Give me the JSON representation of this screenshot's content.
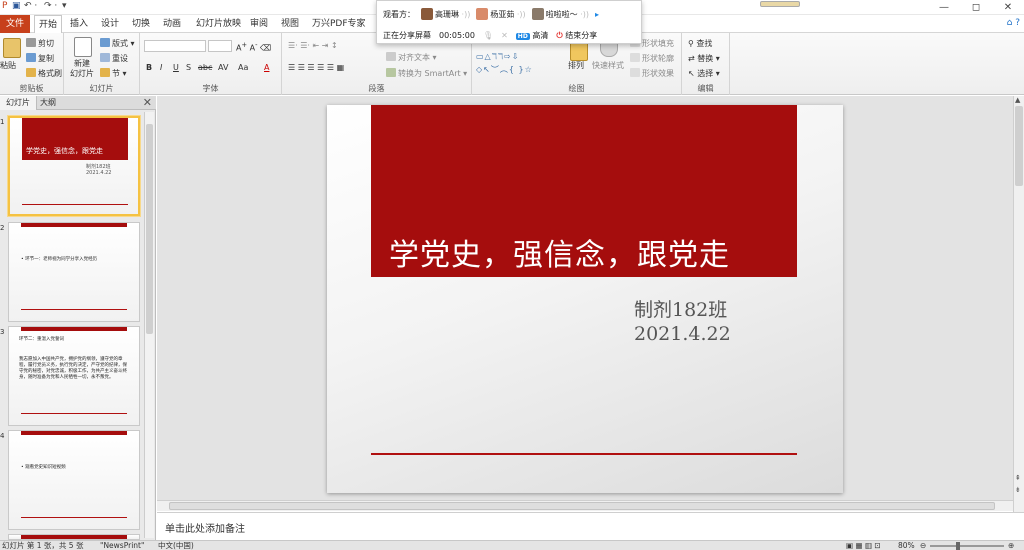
{
  "quick_access": [
    "save-icon",
    "undo-icon",
    "redo-icon"
  ],
  "window_controls": [
    "—",
    "◻",
    "✕"
  ],
  "ribbon_tabs": [
    "文件",
    "开始",
    "插入",
    "设计",
    "切换",
    "动画",
    "幻灯片放映",
    "审阅",
    "视图",
    "万兴PDF专家"
  ],
  "ribbon": {
    "clipboard": {
      "paste": "粘贴",
      "cut": "剪切",
      "copy": "复制",
      "format_painter": "格式刷",
      "label": "剪贴板"
    },
    "slides": {
      "new_slide": "新建\n幻灯片",
      "layout": "版式",
      "reset": "重设",
      "section": "节",
      "label": "幻灯片"
    },
    "font": {
      "label": "字体",
      "bold": "B",
      "italic": "I",
      "underline": "U",
      "strike": "S",
      "abc": "abc",
      "av": "AV",
      "aa": "Aa",
      "a_color": "A"
    },
    "paragraph": {
      "label": "段落",
      "align_text": "对齐文本",
      "smartart": "转换为 SmartArt"
    },
    "drawing": {
      "arrange": "排列",
      "quick_styles": "快速样式",
      "fill": "形状填充",
      "outline": "形状轮廓",
      "effects": "形状效果",
      "label": "绘图"
    },
    "editing": {
      "find": "查找",
      "replace": "替换",
      "select": "选择",
      "label": "编辑"
    }
  },
  "share": {
    "viewers_label": "观看方：",
    "viewers": [
      "高珊琳",
      "杨亚茹",
      "啦啦啦～"
    ],
    "sharing_status": "正在分享屏幕",
    "elapsed": "00:05:00",
    "hd": "HD",
    "hd_label": "高清",
    "end_share": "结束分享"
  },
  "left_pane": {
    "tabs": [
      "幻灯片",
      "大纲"
    ],
    "close": "✕",
    "slides": [
      {
        "number": "1",
        "title": "学党史，强信念，跟党走",
        "sub": "制剂182班\n2021.4.22"
      },
      {
        "number": "2",
        "title": "• 环节一：老师视为同学分享入党经历"
      },
      {
        "number": "3",
        "heading": "环节二：重温入党誓词",
        "body": "我志愿加入中国共产党，拥护党的纲领，遵守党的章程，履行党员义务，执行党的决定，严守党的纪律，保守党的秘密，对党忠诚，积极工作，为共产主义奋斗终身，随时准备为党和人民牺牲一切，永不叛党。"
      },
      {
        "number": "4",
        "title": "• 观看党史知识短视频"
      }
    ]
  },
  "slide": {
    "title": "学党史，强信念，跟党走",
    "subtitle_line1": "制剂182班",
    "subtitle_line2": "2021.4.22"
  },
  "notes_placeholder": "单击此处添加备注",
  "status": {
    "slide_info": "幻灯片 第 1 张，共 5 张",
    "theme": "\"NewsPrint\"",
    "language": "中文(中国)",
    "zoom": "80%"
  },
  "colors": {
    "accent": "#a50d0d",
    "file_tab": "#c7401b"
  }
}
